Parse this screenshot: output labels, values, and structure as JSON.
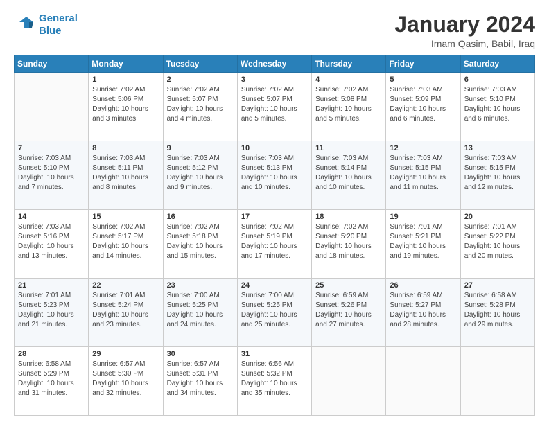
{
  "logo": {
    "line1": "General",
    "line2": "Blue"
  },
  "title": "January 2024",
  "subtitle": "Imam Qasim, Babil, Iraq",
  "days_of_week": [
    "Sunday",
    "Monday",
    "Tuesday",
    "Wednesday",
    "Thursday",
    "Friday",
    "Saturday"
  ],
  "weeks": [
    [
      {
        "day": "",
        "sunrise": "",
        "sunset": "",
        "daylight": ""
      },
      {
        "day": "1",
        "sunrise": "Sunrise: 7:02 AM",
        "sunset": "Sunset: 5:06 PM",
        "daylight": "Daylight: 10 hours and 3 minutes."
      },
      {
        "day": "2",
        "sunrise": "Sunrise: 7:02 AM",
        "sunset": "Sunset: 5:07 PM",
        "daylight": "Daylight: 10 hours and 4 minutes."
      },
      {
        "day": "3",
        "sunrise": "Sunrise: 7:02 AM",
        "sunset": "Sunset: 5:07 PM",
        "daylight": "Daylight: 10 hours and 5 minutes."
      },
      {
        "day": "4",
        "sunrise": "Sunrise: 7:02 AM",
        "sunset": "Sunset: 5:08 PM",
        "daylight": "Daylight: 10 hours and 5 minutes."
      },
      {
        "day": "5",
        "sunrise": "Sunrise: 7:03 AM",
        "sunset": "Sunset: 5:09 PM",
        "daylight": "Daylight: 10 hours and 6 minutes."
      },
      {
        "day": "6",
        "sunrise": "Sunrise: 7:03 AM",
        "sunset": "Sunset: 5:10 PM",
        "daylight": "Daylight: 10 hours and 6 minutes."
      }
    ],
    [
      {
        "day": "7",
        "sunrise": "Sunrise: 7:03 AM",
        "sunset": "Sunset: 5:10 PM",
        "daylight": "Daylight: 10 hours and 7 minutes."
      },
      {
        "day": "8",
        "sunrise": "Sunrise: 7:03 AM",
        "sunset": "Sunset: 5:11 PM",
        "daylight": "Daylight: 10 hours and 8 minutes."
      },
      {
        "day": "9",
        "sunrise": "Sunrise: 7:03 AM",
        "sunset": "Sunset: 5:12 PM",
        "daylight": "Daylight: 10 hours and 9 minutes."
      },
      {
        "day": "10",
        "sunrise": "Sunrise: 7:03 AM",
        "sunset": "Sunset: 5:13 PM",
        "daylight": "Daylight: 10 hours and 10 minutes."
      },
      {
        "day": "11",
        "sunrise": "Sunrise: 7:03 AM",
        "sunset": "Sunset: 5:14 PM",
        "daylight": "Daylight: 10 hours and 10 minutes."
      },
      {
        "day": "12",
        "sunrise": "Sunrise: 7:03 AM",
        "sunset": "Sunset: 5:15 PM",
        "daylight": "Daylight: 10 hours and 11 minutes."
      },
      {
        "day": "13",
        "sunrise": "Sunrise: 7:03 AM",
        "sunset": "Sunset: 5:15 PM",
        "daylight": "Daylight: 10 hours and 12 minutes."
      }
    ],
    [
      {
        "day": "14",
        "sunrise": "Sunrise: 7:03 AM",
        "sunset": "Sunset: 5:16 PM",
        "daylight": "Daylight: 10 hours and 13 minutes."
      },
      {
        "day": "15",
        "sunrise": "Sunrise: 7:02 AM",
        "sunset": "Sunset: 5:17 PM",
        "daylight": "Daylight: 10 hours and 14 minutes."
      },
      {
        "day": "16",
        "sunrise": "Sunrise: 7:02 AM",
        "sunset": "Sunset: 5:18 PM",
        "daylight": "Daylight: 10 hours and 15 minutes."
      },
      {
        "day": "17",
        "sunrise": "Sunrise: 7:02 AM",
        "sunset": "Sunset: 5:19 PM",
        "daylight": "Daylight: 10 hours and 17 minutes."
      },
      {
        "day": "18",
        "sunrise": "Sunrise: 7:02 AM",
        "sunset": "Sunset: 5:20 PM",
        "daylight": "Daylight: 10 hours and 18 minutes."
      },
      {
        "day": "19",
        "sunrise": "Sunrise: 7:01 AM",
        "sunset": "Sunset: 5:21 PM",
        "daylight": "Daylight: 10 hours and 19 minutes."
      },
      {
        "day": "20",
        "sunrise": "Sunrise: 7:01 AM",
        "sunset": "Sunset: 5:22 PM",
        "daylight": "Daylight: 10 hours and 20 minutes."
      }
    ],
    [
      {
        "day": "21",
        "sunrise": "Sunrise: 7:01 AM",
        "sunset": "Sunset: 5:23 PM",
        "daylight": "Daylight: 10 hours and 21 minutes."
      },
      {
        "day": "22",
        "sunrise": "Sunrise: 7:01 AM",
        "sunset": "Sunset: 5:24 PM",
        "daylight": "Daylight: 10 hours and 23 minutes."
      },
      {
        "day": "23",
        "sunrise": "Sunrise: 7:00 AM",
        "sunset": "Sunset: 5:25 PM",
        "daylight": "Daylight: 10 hours and 24 minutes."
      },
      {
        "day": "24",
        "sunrise": "Sunrise: 7:00 AM",
        "sunset": "Sunset: 5:25 PM",
        "daylight": "Daylight: 10 hours and 25 minutes."
      },
      {
        "day": "25",
        "sunrise": "Sunrise: 6:59 AM",
        "sunset": "Sunset: 5:26 PM",
        "daylight": "Daylight: 10 hours and 27 minutes."
      },
      {
        "day": "26",
        "sunrise": "Sunrise: 6:59 AM",
        "sunset": "Sunset: 5:27 PM",
        "daylight": "Daylight: 10 hours and 28 minutes."
      },
      {
        "day": "27",
        "sunrise": "Sunrise: 6:58 AM",
        "sunset": "Sunset: 5:28 PM",
        "daylight": "Daylight: 10 hours and 29 minutes."
      }
    ],
    [
      {
        "day": "28",
        "sunrise": "Sunrise: 6:58 AM",
        "sunset": "Sunset: 5:29 PM",
        "daylight": "Daylight: 10 hours and 31 minutes."
      },
      {
        "day": "29",
        "sunrise": "Sunrise: 6:57 AM",
        "sunset": "Sunset: 5:30 PM",
        "daylight": "Daylight: 10 hours and 32 minutes."
      },
      {
        "day": "30",
        "sunrise": "Sunrise: 6:57 AM",
        "sunset": "Sunset: 5:31 PM",
        "daylight": "Daylight: 10 hours and 34 minutes."
      },
      {
        "day": "31",
        "sunrise": "Sunrise: 6:56 AM",
        "sunset": "Sunset: 5:32 PM",
        "daylight": "Daylight: 10 hours and 35 minutes."
      },
      {
        "day": "",
        "sunrise": "",
        "sunset": "",
        "daylight": ""
      },
      {
        "day": "",
        "sunrise": "",
        "sunset": "",
        "daylight": ""
      },
      {
        "day": "",
        "sunrise": "",
        "sunset": "",
        "daylight": ""
      }
    ]
  ]
}
